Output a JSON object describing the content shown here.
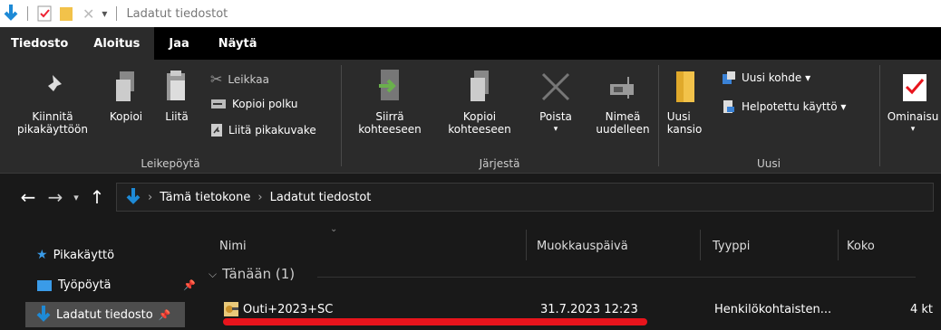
{
  "window": {
    "title": "Ladatut tiedostot"
  },
  "ribbon_tabs": [
    "Tiedosto",
    "Aloitus",
    "Jaa",
    "Näytä"
  ],
  "ribbon": {
    "pin_label": "Kiinnitä\npikakäyttöön",
    "copy_label": "Kopioi",
    "paste_label": "Liitä",
    "cut_label": "Leikkaa",
    "copy_path_label": "Kopioi polku",
    "paste_shortcut_label": "Liitä pikakuvake",
    "clipboard_group": "Leikepöytä",
    "move_label": "Siirrä\nkohteeseen",
    "copyto_label": "Kopioi\nkohteeseen",
    "delete_label": "Poista",
    "rename_label": "Nimeä\nuudelleen",
    "organize_group": "Järjestä",
    "new_folder_label": "Uusi\nkansio",
    "new_item_label": "Uusi kohde ▾",
    "easy_access_label": "Helpotettu käyttö ▾",
    "new_group": "Uusi",
    "properties_label": "Ominaisu"
  },
  "address": {
    "crumbs": [
      "Tämä tietokone",
      "Ladatut tiedostot"
    ]
  },
  "nav": {
    "quick_access": "Pikakäyttö",
    "desktop": "Työpöytä",
    "downloads": "Ladatut tiedosto"
  },
  "columns": [
    "Nimi",
    "Muokkauspäivä",
    "Tyyppi",
    "Koko"
  ],
  "group": {
    "label": "Tänään (1)"
  },
  "file": {
    "name": "Outi+2023+SC",
    "modified": "31.7.2023 12:23",
    "type": "Henkilökohtaisten...",
    "size": "4 kt"
  },
  "colors": {
    "accent": "#1e8ad6",
    "folder": "#f2c24a",
    "highlight": "#e8141c"
  }
}
